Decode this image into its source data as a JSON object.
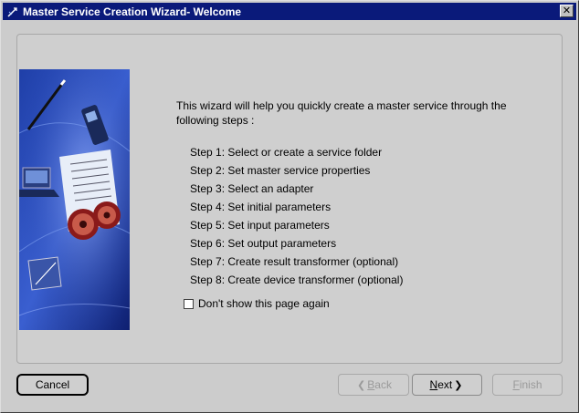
{
  "window": {
    "title": "Master Service Creation Wizard- Welcome",
    "close_glyph": "✕"
  },
  "content": {
    "intro": "This wizard will help you quickly create a master service through the following steps :",
    "steps": [
      "Step 1: Select or create a service folder",
      "Step 2: Set master service properties",
      "Step 3: Select an adapter",
      "Step 4: Set initial parameters",
      "Step 5: Set input parameters",
      "Step 6: Set output parameters",
      "Step 7: Create result transformer (optional)",
      "Step 8: Create device transformer (optional)"
    ],
    "dont_show_label": "Don't show this page again",
    "dont_show_checked": false
  },
  "buttons": {
    "cancel": "Cancel",
    "back_mnemonic": "B",
    "back_rest": "ack",
    "next_mnemonic": "N",
    "next_rest": "ext",
    "finish_mnemonic": "F",
    "finish_rest": "inish"
  },
  "colors": {
    "titlebar": "#0a1a7a",
    "window_bg": "#cccccc",
    "disabled_text": "#9a9a9a"
  }
}
